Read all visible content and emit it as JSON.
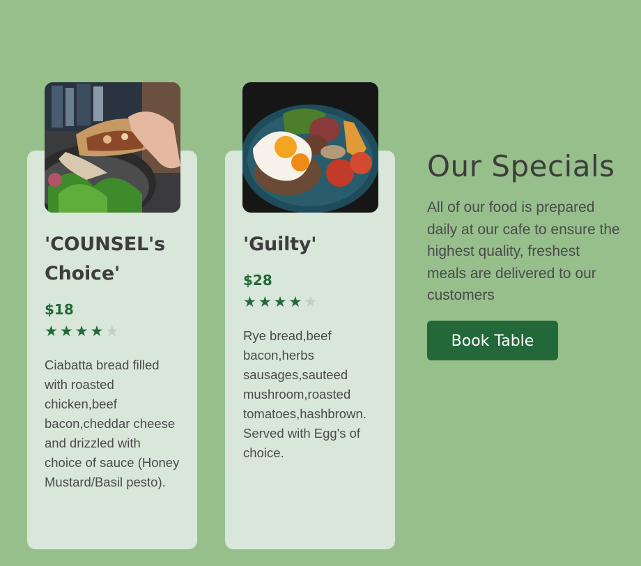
{
  "cards": [
    {
      "title": "'COUNSEL's Choice'",
      "price": "$18",
      "rating": 4,
      "rating_max": 5,
      "description": "Ciabatta bread filled with roasted chicken,beef bacon,cheddar cheese and drizzled with choice of sauce (Honey Mustard/Basil pesto)."
    },
    {
      "title": "'Guilty'",
      "price": "$28",
      "rating": 4,
      "rating_max": 5,
      "description": "Rye bread,beef bacon,herbs sausages,sauteed mushroom,roasted tomatoes,hashbrown. Served with Egg's of choice."
    }
  ],
  "specials": {
    "title": "Our Specials",
    "description": "All of our food is prepared daily at our cafe to ensure the highest quality, freshest meals are delivered to our customers",
    "button_label": "Book Table"
  },
  "colors": {
    "page_background": "#97bf8c",
    "card_background": "#d9e6da",
    "accent": "#236839",
    "star_empty": "#c5cec5",
    "text": "#3d3d3d"
  }
}
